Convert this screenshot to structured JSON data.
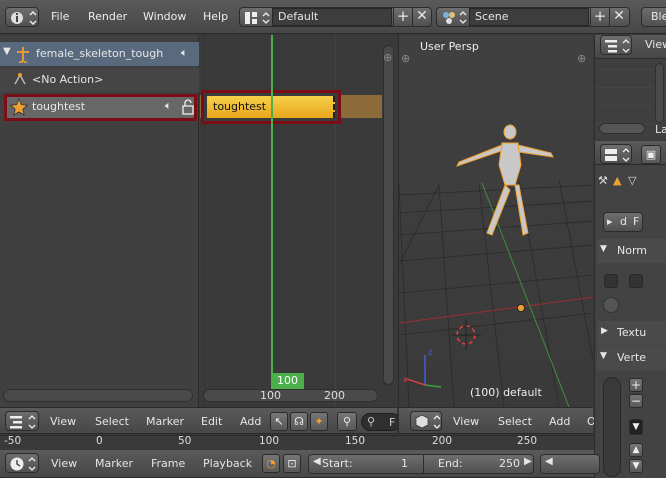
{
  "top_menu": {
    "items": [
      "File",
      "Render",
      "Window",
      "Help"
    ],
    "layout_name": "Default",
    "scene_name": "Scene",
    "engine": "Ble"
  },
  "nla": {
    "channels": [
      {
        "label": "female_skeleton_tough"
      },
      {
        "label": "<No Action>"
      },
      {
        "label": "toughtest"
      }
    ],
    "strip_label": "toughtest",
    "current_frame": "100",
    "scroll_ticks": [
      "100",
      "200"
    ],
    "menu": [
      "View",
      "Select",
      "Marker",
      "Edit",
      "Add"
    ],
    "filter_placeholder": "F"
  },
  "viewport": {
    "view_name": "User Persp",
    "object_info": "(100) default",
    "menu": [
      "View",
      "Select",
      "Add"
    ]
  },
  "properties": {
    "outliner_view_label": "View",
    "layer_label": "La",
    "sections": [
      "Norm",
      "Textu",
      "Verte"
    ],
    "d_label": "d",
    "f_label": "F"
  },
  "timeline": {
    "ruler_ticks": [
      "-50",
      "0",
      "50",
      "100",
      "150",
      "200",
      "250"
    ],
    "menu": [
      "View",
      "Marker",
      "Frame",
      "Playback"
    ],
    "start_label": "Start:",
    "start_value": "1",
    "end_label": "End:",
    "end_value": "250"
  },
  "colors": {
    "selected_outline": "#7a0d16",
    "strip_yellow": "#f2b320",
    "frame_line": "#4caf4c",
    "channel_header": "#5b6b80"
  }
}
